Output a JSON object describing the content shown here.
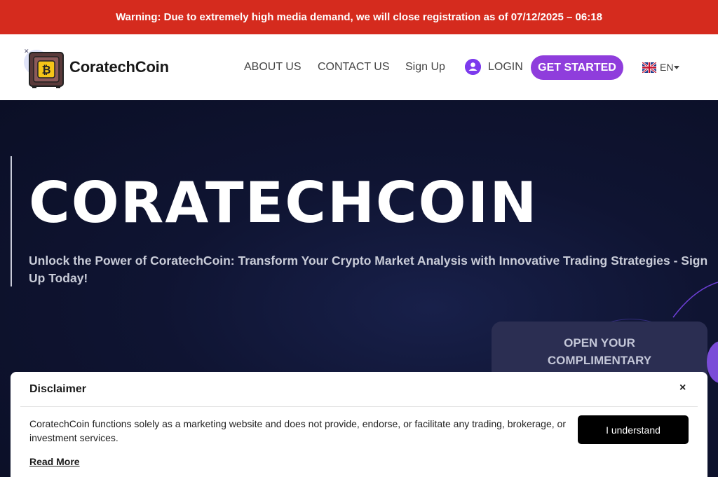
{
  "warning": {
    "text": "Warning: Due to extremely high media demand, we will close registration as of 07/12/2025 – 06:18"
  },
  "header": {
    "brand": "CoratechCoin",
    "nav": {
      "about": "ABOUT US",
      "contact": "CONTACT US",
      "signup": "Sign Up",
      "login": "LOGIN"
    },
    "cta": "GET STARTED",
    "language": "EN"
  },
  "hero": {
    "title": "CORATECHCOIN",
    "subtitle": "Unlock the Power of CoratechCoin: Transform Your Crypto Market Analysis with Innovative Trading Strategies - Sign Up Today!"
  },
  "offer": {
    "title_line1": "OPEN YOUR",
    "title_line2": "COMPLIMENTARY"
  },
  "disclaimer": {
    "title": "Disclaimer",
    "close": "×",
    "text": "CoratechCoin functions solely as a marketing website and does not provide, endorse, or facilitate any trading, brokerage, or investment services.",
    "read_more": "Read More",
    "button": "I understand"
  },
  "colors": {
    "warning_bg": "#d52b1e",
    "accent": "#8f3ddc",
    "hero_bg": "#0d1129"
  },
  "icons": {
    "logo": "bitcoin-safe-icon",
    "login": "user-icon",
    "flag": "uk-flag-icon",
    "caret": "caret-down-icon",
    "close": "close-icon"
  }
}
